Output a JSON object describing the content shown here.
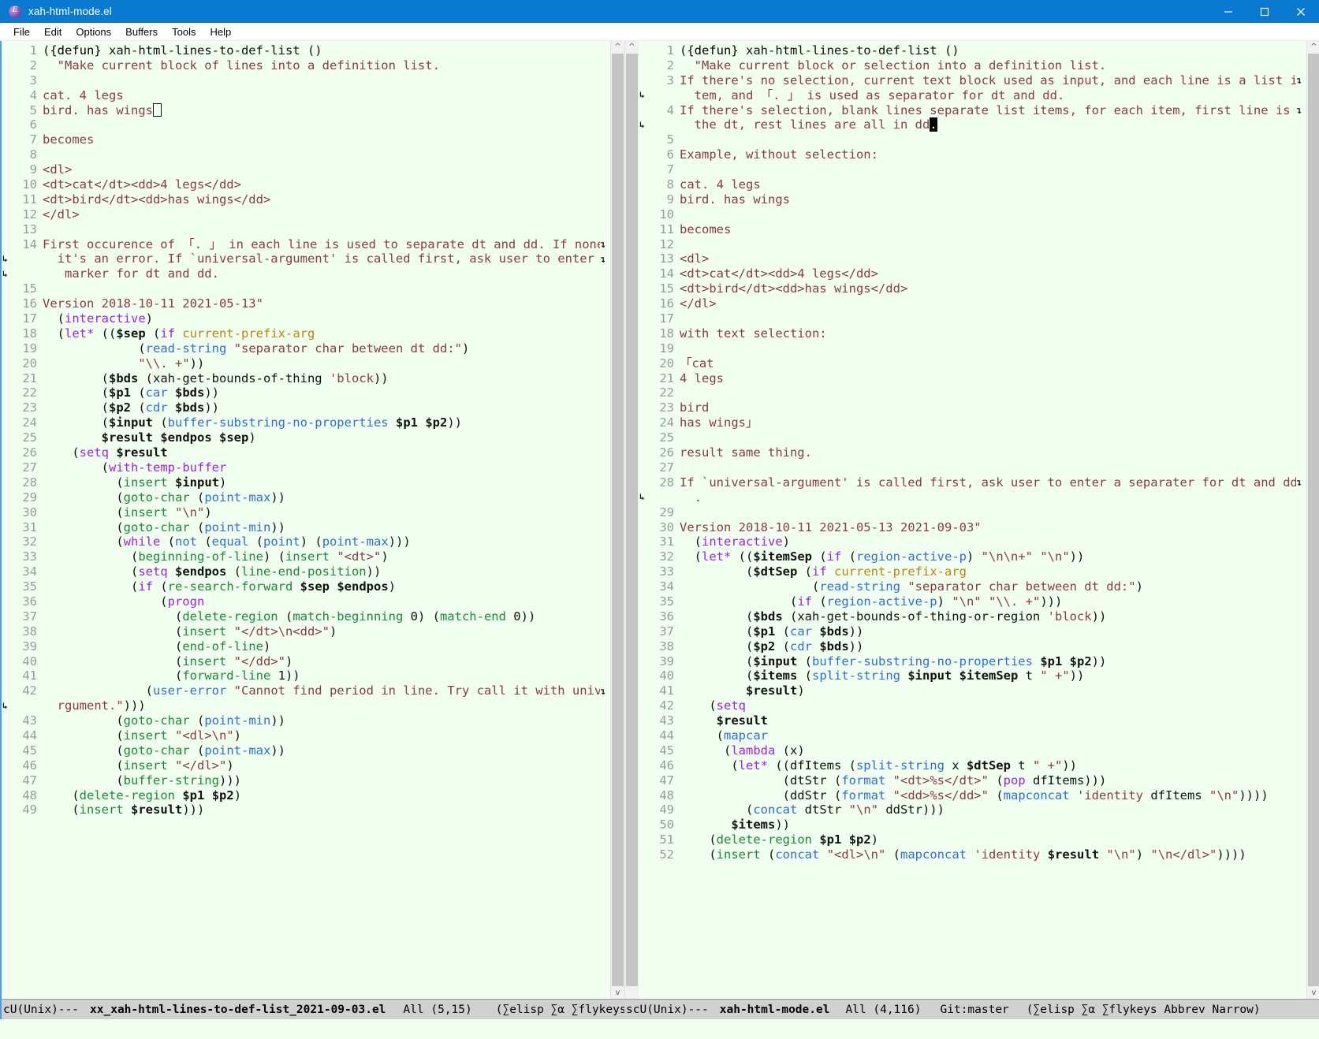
{
  "window": {
    "title": "xah-html-mode.el",
    "icon": "emacs-icon",
    "minimize": "minimize-icon",
    "maximize": "maximize-icon",
    "close": "close-icon"
  },
  "menubar": {
    "items": [
      "File",
      "Edit",
      "Options",
      "Buffers",
      "Tools",
      "Help"
    ]
  },
  "left_pane": {
    "modeline": {
      "coding": "cU(Unix)---",
      "buffer": "xx_xah-html-lines-to-def-list_2021-09-03.el",
      "position": "All (5,15)",
      "modes": "(∑elisp ∑α ∑flykeys"
    },
    "lines": [
      {
        "n": "1",
        "t": "({defun} xah-html-lines-to-def-list ()"
      },
      {
        "n": "2",
        "t": "  {doc:\"Make current block of lines into a definition list.}"
      },
      {
        "n": "3",
        "t": ""
      },
      {
        "n": "4",
        "t": "{doc:cat. 4 legs}"
      },
      {
        "n": "5",
        "t": "{doc:bird. has wings}{hollowcursor}"
      },
      {
        "n": "6",
        "t": ""
      },
      {
        "n": "7",
        "t": "{doc:becomes}"
      },
      {
        "n": "8",
        "t": ""
      },
      {
        "n": "9",
        "t": "{doc:<dl>}"
      },
      {
        "n": "10",
        "t": "{doc:<dt>cat</dt><dd>4 legs</dd>}"
      },
      {
        "n": "11",
        "t": "{doc:<dt>bird</dt><dd>has wings</dd>}"
      },
      {
        "n": "12",
        "t": "{doc:</dl>}"
      },
      {
        "n": "13",
        "t": ""
      },
      {
        "n": "14",
        "t": "{doc:First occurence of 「. 」 in each line is used to separate dt and dd. If none found,}",
        "cont": true
      },
      {
        "n": "",
        "t": "  {doc:it's an error. If `universal-argument' is called first, ask user to enter a separater}",
        "contleft": true,
        "cont": true
      },
      {
        "n": "",
        "t": "  {doc: marker for dt and dd.}",
        "contleft": true
      },
      {
        "n": "15",
        "t": ""
      },
      {
        "n": "16",
        "t": "{doc:Version 2018-10-11 2021-05-13\"}"
      },
      {
        "n": "17",
        "t": "  ({kw:interactive})"
      },
      {
        "n": "18",
        "t": "  ({kw:let*} (({b:$sep} ({kw:if} {var:current-prefix-arg}"
      },
      {
        "n": "19",
        "t": "             ({fn:read-string} {str:\"separator char between dt dd:\"})"
      },
      {
        "n": "20",
        "t": "             {str:\"\\\\. +\"}))"
      },
      {
        "n": "21",
        "t": "        ({b:$bds} (xah-get-bounds-of-thing {str:'block}))"
      },
      {
        "n": "22",
        "t": "        ({b:$p1} ({fn:car} {b:$bds}))"
      },
      {
        "n": "23",
        "t": "        ({b:$p2} ({fn:cdr} {b:$bds}))"
      },
      {
        "n": "24",
        "t": "        ({b:$input} ({fn:buffer-substring-no-properties} {b:$p1} {b:$p2}))"
      },
      {
        "n": "25",
        "t": "        {b:$result} {b:$endpos} {b:$sep})"
      },
      {
        "n": "26",
        "t": "    ({kw:setq} {b:$result}"
      },
      {
        "n": "27",
        "t": "        ({kw:with-temp-buffer}"
      },
      {
        "n": "28",
        "t": "          ({fn2:insert} {b:$input})"
      },
      {
        "n": "29",
        "t": "          ({fn2:goto-char} ({fn:point-max}))"
      },
      {
        "n": "30",
        "t": "          ({fn2:insert} {str:\"\\n\"})"
      },
      {
        "n": "31",
        "t": "          ({fn2:goto-char} ({fn:point-min}))"
      },
      {
        "n": "32",
        "t": "          ({kw:while} ({fn:not} ({fn:equal} ({fn:point}) ({fn:point-max})))"
      },
      {
        "n": "33",
        "t": "            ({fn2:beginning-of-line}) ({fn2:insert} {str:\"<dt>\"})"
      },
      {
        "n": "34",
        "t": "            ({kw:setq} {b:$endpos} ({fn2:line-end-position}))"
      },
      {
        "n": "35",
        "t": "            ({kw:if} ({fn2:re-search-forward} {b:$sep} {b:$endpos})"
      },
      {
        "n": "36",
        "t": "                ({kw:progn}"
      },
      {
        "n": "37",
        "t": "                  ({fn2:delete-region} ({fn2:match-beginning} 0) ({fn2:match-end} 0))"
      },
      {
        "n": "38",
        "t": "                  ({fn2:insert} {str:\"</dt>\\n<dd>\"})"
      },
      {
        "n": "39",
        "t": "                  ({fn2:end-of-line})"
      },
      {
        "n": "40",
        "t": "                  ({fn2:insert} {str:\"</dd>\"})"
      },
      {
        "n": "41",
        "t": "                  ({fn2:forward-line} 1))"
      },
      {
        "n": "42",
        "t": "              ({fn:user-error} {str:\"Cannot find period in line. Try call it with universal-a}",
        "cont": true
      },
      {
        "n": "",
        "t": "  {str:rgument.\"})))",
        "contleft": true
      },
      {
        "n": "43",
        "t": "          ({fn2:goto-char} ({fn:point-min}))"
      },
      {
        "n": "44",
        "t": "          ({fn2:insert} {str:\"<dl>\\n\"})"
      },
      {
        "n": "45",
        "t": "          ({fn2:goto-char} ({fn:point-max}))"
      },
      {
        "n": "46",
        "t": "          ({fn2:insert} {str:\"</dl>\"})"
      },
      {
        "n": "47",
        "t": "          ({fn2:buffer-string})))"
      },
      {
        "n": "48",
        "t": "    ({fn2:delete-region} {b:$p1} {b:$p2})"
      },
      {
        "n": "49",
        "t": "    ({fn2:insert} {b:$result})))"
      }
    ]
  },
  "right_pane": {
    "modeline": {
      "coding": "scU(Unix)---",
      "buffer": "xah-html-mode.el",
      "position": "All (4,116)",
      "vc": "Git:master",
      "modes": "(∑elisp ∑α ∑flykeys Abbrev Narrow)"
    },
    "lines": [
      {
        "n": "1",
        "t": "({defun} xah-html-lines-to-def-list ()"
      },
      {
        "n": "2",
        "t": "  {doc:\"Make current block or selection into a definition list.}"
      },
      {
        "n": "3",
        "t": "{doc:If there's no selection, current text block used as input, and each line is a list i}",
        "cont": true
      },
      {
        "n": "",
        "t": "  {doc:tem, and 「. 」 is used as separator for dt and dd.}",
        "contleft": true
      },
      {
        "n": "4",
        "t": "{doc:If there's selection, blank lines separate list items, for each item, first line is}",
        "cont": true
      },
      {
        "n": "",
        "t": "  {doc:the dt, rest lines are all in dd}{cursor:.}",
        "contleft": true
      },
      {
        "n": "5",
        "t": ""
      },
      {
        "n": "6",
        "t": "{doc:Example, without selection:}"
      },
      {
        "n": "7",
        "t": ""
      },
      {
        "n": "8",
        "t": "{doc:cat. 4 legs}"
      },
      {
        "n": "9",
        "t": "{doc:bird. has wings}"
      },
      {
        "n": "10",
        "t": ""
      },
      {
        "n": "11",
        "t": "{doc:becomes}"
      },
      {
        "n": "12",
        "t": ""
      },
      {
        "n": "13",
        "t": "{doc:<dl>}"
      },
      {
        "n": "14",
        "t": "{doc:<dt>cat</dt><dd>4 legs</dd>}"
      },
      {
        "n": "15",
        "t": "{doc:<dt>bird</dt><dd>has wings</dd>}"
      },
      {
        "n": "16",
        "t": "{doc:</dl>}"
      },
      {
        "n": "17",
        "t": ""
      },
      {
        "n": "18",
        "t": "{doc:with text selection:}"
      },
      {
        "n": "19",
        "t": ""
      },
      {
        "n": "20",
        "t": "{doc:「cat}"
      },
      {
        "n": "21",
        "t": "{doc:4 legs}"
      },
      {
        "n": "22",
        "t": ""
      },
      {
        "n": "23",
        "t": "{doc:bird}"
      },
      {
        "n": "24",
        "t": "{doc:has wings」}"
      },
      {
        "n": "25",
        "t": ""
      },
      {
        "n": "26",
        "t": "{doc:result same thing.}"
      },
      {
        "n": "27",
        "t": ""
      },
      {
        "n": "28",
        "t": "{doc:If `universal-argument' is called first, ask user to enter a separater for dt and dd}",
        "cont": true
      },
      {
        "n": "",
        "t": "  {doc:.}",
        "contleft": true
      },
      {
        "n": "29",
        "t": ""
      },
      {
        "n": "30",
        "t": "{doc:Version 2018-10-11 2021-05-13 2021-09-03\"}"
      },
      {
        "n": "31",
        "t": "  ({kw:interactive})"
      },
      {
        "n": "32",
        "t": "  ({kw:let*} (({b:$itemSep} ({kw:if} ({fn:region-active-p}) {str:\"\\n\\n+\"} {str:\"\\n\"}))"
      },
      {
        "n": "33",
        "t": "         ({b:$dtSep} ({kw:if} {var:current-prefix-arg}"
      },
      {
        "n": "34",
        "t": "                  ({fn:read-string} {str:\"separator char between dt dd:\"})"
      },
      {
        "n": "35",
        "t": "               ({kw:if} ({fn:region-active-p}) {str:\"\\n\"} {str:\"\\\\. +\"})))"
      },
      {
        "n": "36",
        "t": "         ({b:$bds} (xah-get-bounds-of-thing-or-region {str:'block}))"
      },
      {
        "n": "37",
        "t": "         ({b:$p1} ({fn:car} {b:$bds}))"
      },
      {
        "n": "38",
        "t": "         ({b:$p2} ({fn:cdr} {b:$bds}))"
      },
      {
        "n": "39",
        "t": "         ({b:$input} ({fn:buffer-substring-no-properties} {b:$p1} {b:$p2}))"
      },
      {
        "n": "40",
        "t": "         ({b:$items} ({fn:split-string} {b:$input} {b:$itemSep} t {str:\" +\"}))"
      },
      {
        "n": "41",
        "t": "         {b:$result})"
      },
      {
        "n": "42",
        "t": "    ({kw:setq}"
      },
      {
        "n": "43",
        "t": "     {b:$result}"
      },
      {
        "n": "44",
        "t": "     ({fn:mapcar}"
      },
      {
        "n": "45",
        "t": "      ({kw:lambda} (x)"
      },
      {
        "n": "46",
        "t": "       ({kw:let*} ((dfItems ({fn:split-string} x {b:$dtSep} t {str:\" +\"}))"
      },
      {
        "n": "47",
        "t": "              (dtStr ({fn:format} {str:\"<dt>%s</dt>\"} ({kw:pop} dfItems)))"
      },
      {
        "n": "48",
        "t": "              (ddStr ({fn:format} {str:\"<dd>%s</dd>\"} ({fn:mapconcat} {str:'identity} dfItems {str:\"\\n\"}))))"
      },
      {
        "n": "49",
        "t": "         ({fn:concat} dtStr {str:\"\\n\"} ddStr)))"
      },
      {
        "n": "50",
        "t": "       {b:$items}))"
      },
      {
        "n": "51",
        "t": "    ({fn2:delete-region} {b:$p1} {b:$p2})"
      },
      {
        "n": "52",
        "t": "    ({fn2:insert} ({fn:concat} {str:\"<dl>\\n\"} ({fn:mapconcat} {str:'identity} {b:$result} {str:\"\\n\"}) {str:\"\\n</dl>\"})))) "
      }
    ]
  },
  "colors": {
    "background": "#f0fff0",
    "titlebar": "#0a7ad1",
    "modeline": "#d0d0d0",
    "keyword": "#a020f0",
    "string": "#8b3a48",
    "builtin": "#2f6fd0",
    "function": "#1a8a34",
    "variable": "#b8860b",
    "linenumber": "#9a9a9a"
  }
}
